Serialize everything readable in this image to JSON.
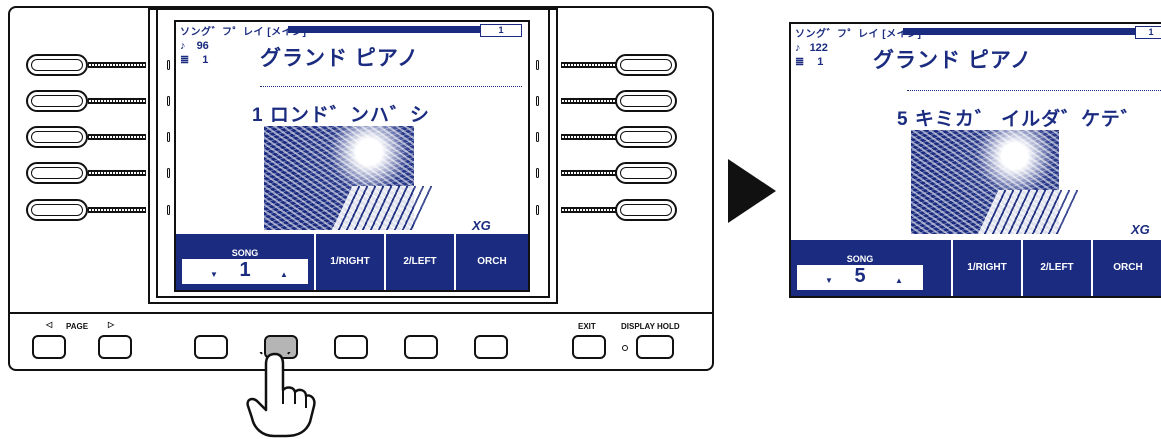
{
  "screen": {
    "title": "ソング゛フ゜レイ [メイン]",
    "page_indicator": "1",
    "voice_name": "グランド ピアノ",
    "tempo": "96",
    "measure": "1",
    "song_title": "1 ロンド゛ンハ゛シ",
    "logo": "XG",
    "song_label": "SONG",
    "song_number": "1",
    "softkeys": [
      "1/RIGHT",
      "2/LEFT",
      "ORCH"
    ]
  },
  "result_screen": {
    "title": "ソング゛フ゜レイ [メイン]",
    "page_indicator": "1",
    "voice_name": "グランド ピアノ",
    "tempo": "122",
    "measure": "1",
    "song_title": "5 キミカ゛ イルダ゛ケテ゛",
    "logo": "XG",
    "song_label": "SONG",
    "song_number": "5",
    "softkeys": [
      "1/RIGHT",
      "2/LEFT",
      "ORCH"
    ]
  },
  "panel": {
    "page_label": "PAGE",
    "exit_label": "EXIT",
    "display_hold_label": "DISPLAY HOLD"
  },
  "icons": [
    "metronome-icon",
    "measure-icon",
    "arrow-down-icon",
    "arrow-up-icon",
    "page-left-icon",
    "page-right-icon",
    "pointing-hand-icon",
    "next-step-arrow-icon"
  ],
  "colors": {
    "lcd_blue": "#1b2c80",
    "pressed_button": "#b5b5b5"
  }
}
